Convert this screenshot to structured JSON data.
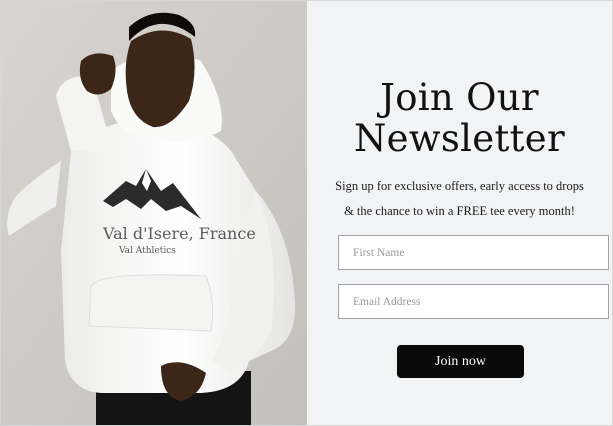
{
  "photo": {
    "alt": "Model wearing white hoodie",
    "print_line1": "Val d'Isere, France",
    "print_line2": "Val Athletics"
  },
  "newsletter": {
    "headline_line1": "Join Our",
    "headline_line2": "Newsletter",
    "subtitle_line1": "Sign up for exclusive offers, early access to drops",
    "subtitle_line2": "& the chance to win a FREE tee every month!",
    "first_name_placeholder": "First Name",
    "email_placeholder": "Email Address",
    "submit_label": "Join now"
  },
  "colors": {
    "panel_bg": "#f2f3f5",
    "button_bg": "#0a0a0a",
    "button_text": "#ffffff",
    "field_border": "#9fa3a8"
  }
}
